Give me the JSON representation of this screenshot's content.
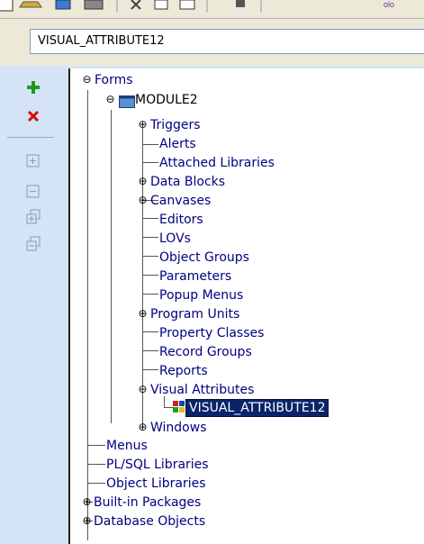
{
  "name_field": {
    "value": "VISUAL_ATTRIBUTE12"
  },
  "toolbar": {
    "corner_text": "olo"
  },
  "left_tools": [
    "add-icon",
    "delete-icon",
    "expand-icon",
    "collapse-icon",
    "expand-all-icon",
    "collapse-all-icon"
  ],
  "tree": {
    "forms": "Forms",
    "module": "MODULE2",
    "module_children": {
      "triggers": "Triggers",
      "alerts": "Alerts",
      "attached_libraries": "Attached Libraries",
      "data_blocks": "Data Blocks",
      "canvases": "Canvases",
      "editors": "Editors",
      "lovs": "LOVs",
      "object_groups": "Object Groups",
      "parameters": "Parameters",
      "popup_menus": "Popup Menus",
      "program_units": "Program Units",
      "property_classes": "Property Classes",
      "record_groups": "Record Groups",
      "reports": "Reports",
      "visual_attributes": "Visual Attributes",
      "visual_attribute_item": "VISUAL_ATTRIBUTE12",
      "windows": "Windows"
    },
    "menus": "Menus",
    "plsql_libraries": "PL/SQL Libraries",
    "object_libraries": "Object Libraries",
    "builtin_packages": "Built-in Packages",
    "database_objects": "Database Objects"
  },
  "colors": {
    "selection": "#0a246a",
    "node_text": "#000080",
    "panel": "#d4e3f5"
  }
}
